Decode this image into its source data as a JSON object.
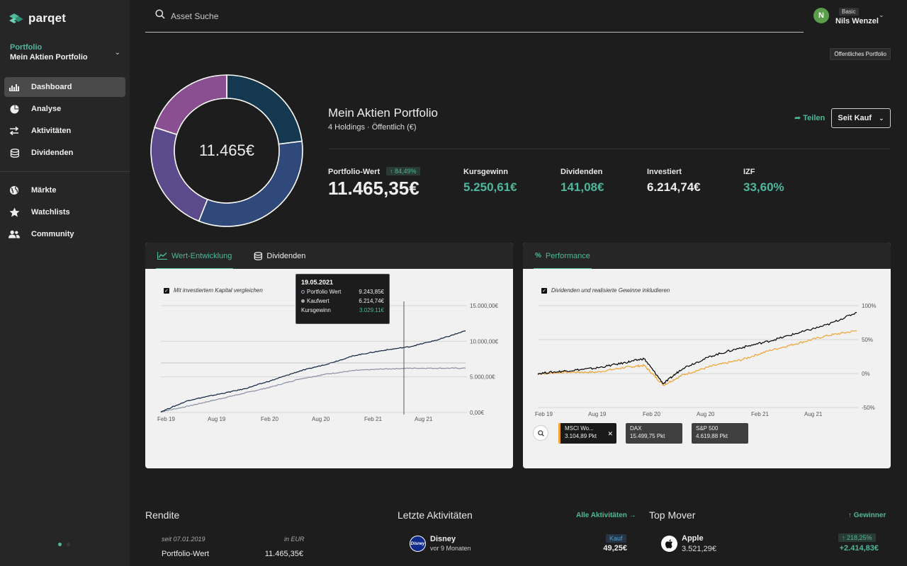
{
  "app": {
    "logo_text": "parqet"
  },
  "sidebar": {
    "portfolio_label": "Portfolio",
    "portfolio_name": "Mein Aktien Portfolio",
    "items": [
      {
        "label": "Dashboard",
        "icon": "chart-icon",
        "active": true
      },
      {
        "label": "Analyse",
        "icon": "pie-icon"
      },
      {
        "label": "Aktivitäten",
        "icon": "transfer-icon"
      },
      {
        "label": "Dividenden",
        "icon": "coins-icon"
      },
      {
        "label": "Märkte",
        "icon": "globe-icon"
      },
      {
        "label": "Watchlists",
        "icon": "star-icon"
      },
      {
        "label": "Community",
        "icon": "users-icon"
      }
    ]
  },
  "header": {
    "search_placeholder": "Asset Suche",
    "user_initial": "N",
    "user_plan": "Basic",
    "user_name": "Nils Wenzel",
    "public_badge": "Öffentliches Portfolio"
  },
  "overview": {
    "donut_center": "11.465€",
    "donut_colors": [
      "#13384f",
      "#2f4a7a",
      "#5b4a8c",
      "#8a4f91"
    ],
    "donut_share": [
      0.23,
      0.33,
      0.24,
      0.2
    ],
    "title": "Mein Aktien Portfolio",
    "subtitle": "4 Holdings · Öffentlich (€)",
    "share_label": "Teilen",
    "period_label": "Seit Kauf",
    "portfolio_value_label": "Portfolio-Wert",
    "portfolio_value_badge": "↑ 84,49%",
    "portfolio_value": "11.465,35€",
    "metrics": [
      {
        "label": "Kursgewinn",
        "value": "5.250,61€",
        "color": "green"
      },
      {
        "label": "Dividenden",
        "value": "141,08€",
        "color": "green"
      },
      {
        "label": "Investiert",
        "value": "6.214,74€",
        "color": "white"
      },
      {
        "label": "IZF",
        "value": "33,60%",
        "color": "green"
      }
    ]
  },
  "left_panel": {
    "tabs": [
      {
        "label": "Wert-Entwicklung",
        "active": true
      },
      {
        "label": "Dividenden",
        "active": false
      }
    ],
    "checkbox_label": "Mit investiertem Kapital vergleichen",
    "tooltip": {
      "date": "19.05.2021",
      "rows": [
        {
          "label": "Portfolio Wert",
          "value": "9.243,85€"
        },
        {
          "label": "Kaufwert",
          "value": "6.214,74€"
        },
        {
          "label": "Kursgewinn",
          "value": "3.029,11€"
        }
      ]
    }
  },
  "right_panel": {
    "tabs": [
      {
        "label": "Performance",
        "active": true
      }
    ],
    "checkbox_label": "Dividenden und realisierte Gewinne inkludieren",
    "indices": [
      {
        "name": "MSCI Wo...",
        "value": "3.104,89 Pkt",
        "selected": true
      },
      {
        "name": "DAX",
        "value": "15.499,75 Pkt",
        "selected": false
      },
      {
        "name": "S&P 500",
        "value": "4.619,88 Pkt",
        "selected": false
      }
    ]
  },
  "chart_data": [
    {
      "type": "line",
      "x_ticks": [
        "Feb 19",
        "Aug 19",
        "Feb 20",
        "Aug 20",
        "Feb 21",
        "Aug 21"
      ],
      "y_ticks": [
        "15.000,00€",
        "10.000,00€",
        "5.000,00€",
        "0,00€"
      ],
      "ylim": [
        0,
        15000
      ],
      "x": [
        "2019-02",
        "2019-05",
        "2019-08",
        "2019-11",
        "2020-02",
        "2020-05",
        "2020-08",
        "2020-11",
        "2021-02",
        "2021-05",
        "2021-08",
        "2021-11"
      ],
      "series": [
        {
          "name": "Portfolio Wert",
          "values": [
            100,
            1700,
            2500,
            3300,
            4500,
            5800,
            6800,
            8000,
            8700,
            9244,
            10200,
            11465
          ],
          "color": "#0b1f3a"
        },
        {
          "name": "Kaufwert",
          "values": [
            100,
            900,
            1800,
            2700,
            3600,
            4700,
            5400,
            5900,
            6100,
            6215,
            6215,
            6215
          ],
          "color": "#8a8fa3"
        }
      ]
    },
    {
      "type": "line",
      "x_ticks": [
        "Feb 19",
        "Aug 19",
        "Feb 20",
        "Aug 20",
        "Feb 21",
        "Aug 21"
      ],
      "y_ticks": [
        "100%",
        "50%",
        "0%",
        "-50%"
      ],
      "ylim": [
        -50,
        100
      ],
      "x": [
        "2019-02",
        "2019-05",
        "2019-08",
        "2019-11",
        "2020-01",
        "2020-03",
        "2020-05",
        "2020-08",
        "2020-11",
        "2021-02",
        "2021-05",
        "2021-08",
        "2021-11"
      ],
      "series": [
        {
          "name": "Portfolio",
          "values": [
            0,
            4,
            8,
            16,
            22,
            -15,
            8,
            26,
            38,
            48,
            60,
            72,
            90
          ],
          "color": "#000000"
        },
        {
          "name": "MSCI Wo...",
          "values": [
            0,
            2,
            2,
            9,
            12,
            -17,
            -2,
            11,
            20,
            34,
            45,
            56,
            63
          ],
          "color": "#f0a330"
        }
      ]
    }
  ],
  "bottom": {
    "rendite": {
      "title": "Rendite",
      "since": "seit 07.01.2019",
      "currency": "in EUR",
      "row_label": "Portfolio-Wert",
      "row_value": "11.465,35€"
    },
    "activities": {
      "title": "Letzte Aktivitäten",
      "link": "Alle Aktivitäten →",
      "item": {
        "name": "Disney",
        "time": "vor 9 Monaten",
        "badge": "Kauf",
        "amount": "49,25€",
        "logo_text": "Disney"
      }
    },
    "movers": {
      "title": "Top Mover",
      "link": "↑ Gewinner",
      "item": {
        "name": "Apple",
        "price": "3.521,29€",
        "badge": "↑ 218,25%",
        "gain": "+2.414,83€"
      }
    }
  }
}
